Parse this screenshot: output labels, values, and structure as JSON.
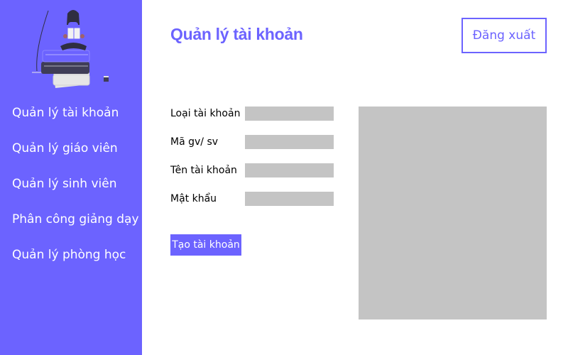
{
  "header": {
    "title": "Quản lý tài khoản",
    "logout_label": "Đăng xuất"
  },
  "sidebar": {
    "illustration": "person-reading-on-books-icon",
    "items": [
      {
        "label": "Quản lý tài khoản"
      },
      {
        "label": "Quản lý giáo viên"
      },
      {
        "label": "Quản lý sinh viên"
      },
      {
        "label": "Phân công giảng dạy"
      },
      {
        "label": "Quản lý phòng học"
      }
    ]
  },
  "form": {
    "fields": [
      {
        "label": "Loại tài khoản",
        "value": ""
      },
      {
        "label": "Mã gv/ sv",
        "value": ""
      },
      {
        "label": "Tên tài khoản",
        "value": ""
      },
      {
        "label": "Mật khẩu",
        "value": ""
      }
    ],
    "submit_label": "Tạo tài khoản"
  },
  "colors": {
    "accent": "#6c63ff",
    "field_background": "#c4c4c4",
    "panel_background": "#c4c4c4"
  }
}
